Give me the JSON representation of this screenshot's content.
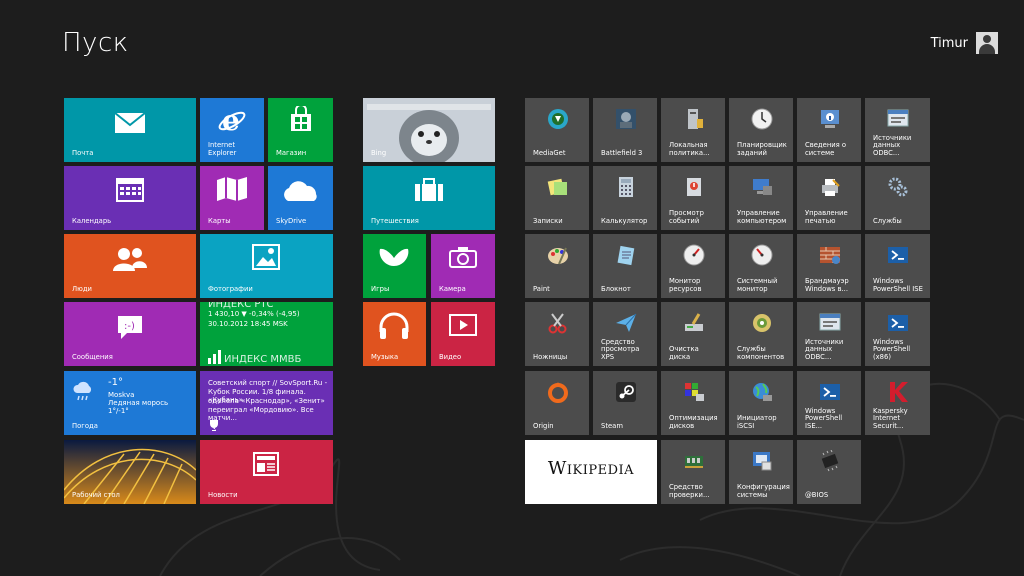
{
  "header": {
    "title": "Пуск",
    "user_name": "Timur"
  },
  "tiles_group1": {
    "mail": "Почта",
    "ie": "Internet Explorer",
    "store": "Магазин",
    "calendar": "Календарь",
    "maps": "Карты",
    "skydrive": "SkyDrive",
    "people": "Люди",
    "photos": "Фотографии",
    "finance": {
      "title": "ИНДЕКС РТС",
      "line1": "1 430,10  ▼ -0,34% (-4,95)",
      "line2": "30.10.2012 18:45 MSK",
      "title2": "ИНДЕКС ММВБ"
    },
    "messaging": "Сообщения",
    "weather": {
      "temp": "-1°",
      "city": "Moskva",
      "condition": "Ледяная морось",
      "range": "1°/-1°",
      "label": "Погода"
    },
    "sport": {
      "line1": "Советский спорт // SovSport.Ru -",
      "line2": "Кубок России. 1/8 финала. «Кубань»",
      "line3": "одолела «Краснодар», «Зенит»",
      "line4": "переиграл «Мордовию». Все матчи..."
    },
    "desktop": "Рабочий стол",
    "news": "Новости"
  },
  "tiles_group2": {
    "bing": "Bing",
    "travel": "Путешествия",
    "games": "Игры",
    "camera": "Камера",
    "music": "Музыка",
    "video": "Видео"
  },
  "tiles_group3": {
    "mediaget": "MediaGet",
    "bf3": "Battlefield 3",
    "secpol": [
      "Локальная",
      "политика..."
    ],
    "scheduler": [
      "Планировщик",
      "заданий"
    ],
    "sysinfo": [
      "Сведения о",
      "системе"
    ],
    "odbc32": [
      "Источники",
      "данных ODBC..."
    ],
    "notes": "Записки",
    "calc": "Калькулятор",
    "events": [
      "Просмотр",
      "событий"
    ],
    "compmgmt": [
      "Управление",
      "компьютером"
    ],
    "printmgmt": [
      "Управление",
      "печатью"
    ],
    "services": "Службы",
    "paint": "Paint",
    "notepad": "Блокнот",
    "resmon": [
      "Монитор",
      "ресурсов"
    ],
    "perfmon": [
      "Системный",
      "монитор"
    ],
    "firewall": [
      "Брандмауэр",
      "Windows в..."
    ],
    "psise": [
      "Windows",
      "PowerShell ISE"
    ],
    "snip": "Ножницы",
    "xps": [
      "Средство",
      "просмотра XPS"
    ],
    "cleanup": "Очистка диска",
    "comsvcs": [
      "Службы",
      "компонентов"
    ],
    "odbc64": [
      "Источники",
      "данных ODBC..."
    ],
    "ps86": [
      "Windows",
      "PowerShell (x86)"
    ],
    "origin": "Origin",
    "steam": "Steam",
    "defrag": [
      "Оптимизация",
      "дисков"
    ],
    "iscsi": "Инициатор iSCSI",
    "psise2": [
      "Windows",
      "PowerShell ISE..."
    ],
    "kaspersky": [
      "Kaspersky",
      "Internet Securit..."
    ],
    "wikipedia": "Wikipedia",
    "memcheck": [
      "Средство",
      "проверки..."
    ],
    "msconfig": [
      "Конфигурация",
      "системы"
    ],
    "bios": "@BIOS"
  },
  "colors": {
    "bg": "#1d1d1d",
    "teal": "#0097a8",
    "blue": "#1e79d6",
    "green": "#00a23c",
    "purple": "#6a2fb4",
    "magenta": "#a02bb4",
    "orange": "#e0531f",
    "cyan": "#0aa3c2",
    "red": "#cb2444",
    "gray": "#4c4c4c"
  }
}
